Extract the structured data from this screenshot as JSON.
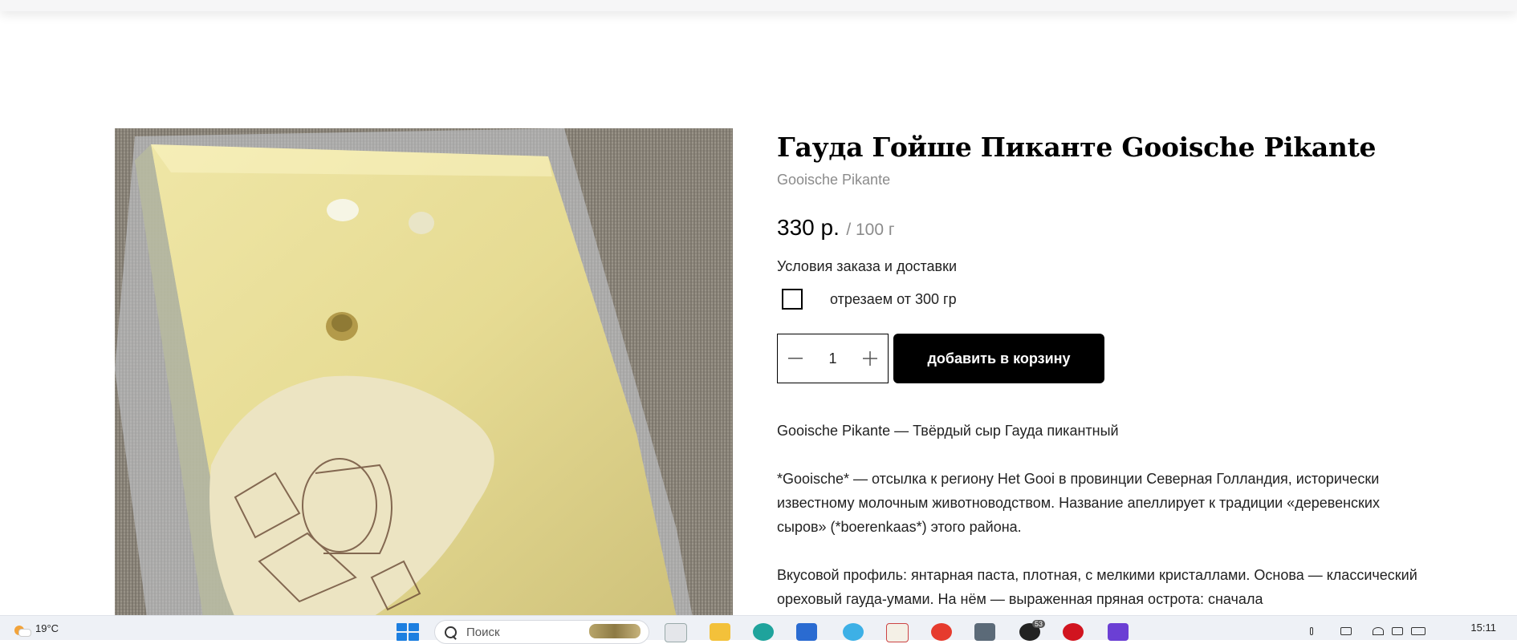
{
  "product": {
    "title": "Гауда Гойше Пиканте Gooische Pikante",
    "subtitle": "Gooische Pikante",
    "price": "330 р.",
    "unit": "/ 100 г",
    "conditions_link": "Условия заказа и доставки",
    "option_label": "отрезаем от 300 гр",
    "option_checked": false,
    "quantity": "1",
    "add_to_cart": "добавить в корзину",
    "image_alt": "сыр Гауда Гойше Пиканте",
    "description": [
      "Gooische Pikante — Твёрдый сыр Гауда пикантный",
      "*Gooische* — отсылка к региону Het Gooi в провинции Северная Голландия, исторически известному молочным животноводством. Название апеллирует к традиции «деревенских сыров» (*boerenkaas*) этого района.",
      "Вкусовой профиль: янтарная паста, плотная, с мелкими кристаллами. Основа — классический ореховый гауда-умами. На нём — выраженная пряная острота: сначала"
    ]
  },
  "taskbar": {
    "weather_temp": "19°C",
    "search_placeholder": "Поиск",
    "badge_count": "53",
    "time": "15:11"
  },
  "colors": {
    "accent": "#000000",
    "muted_text": "#8b8b8b",
    "body_text": "#222222",
    "taskbar_bg": "#eef1f6"
  }
}
